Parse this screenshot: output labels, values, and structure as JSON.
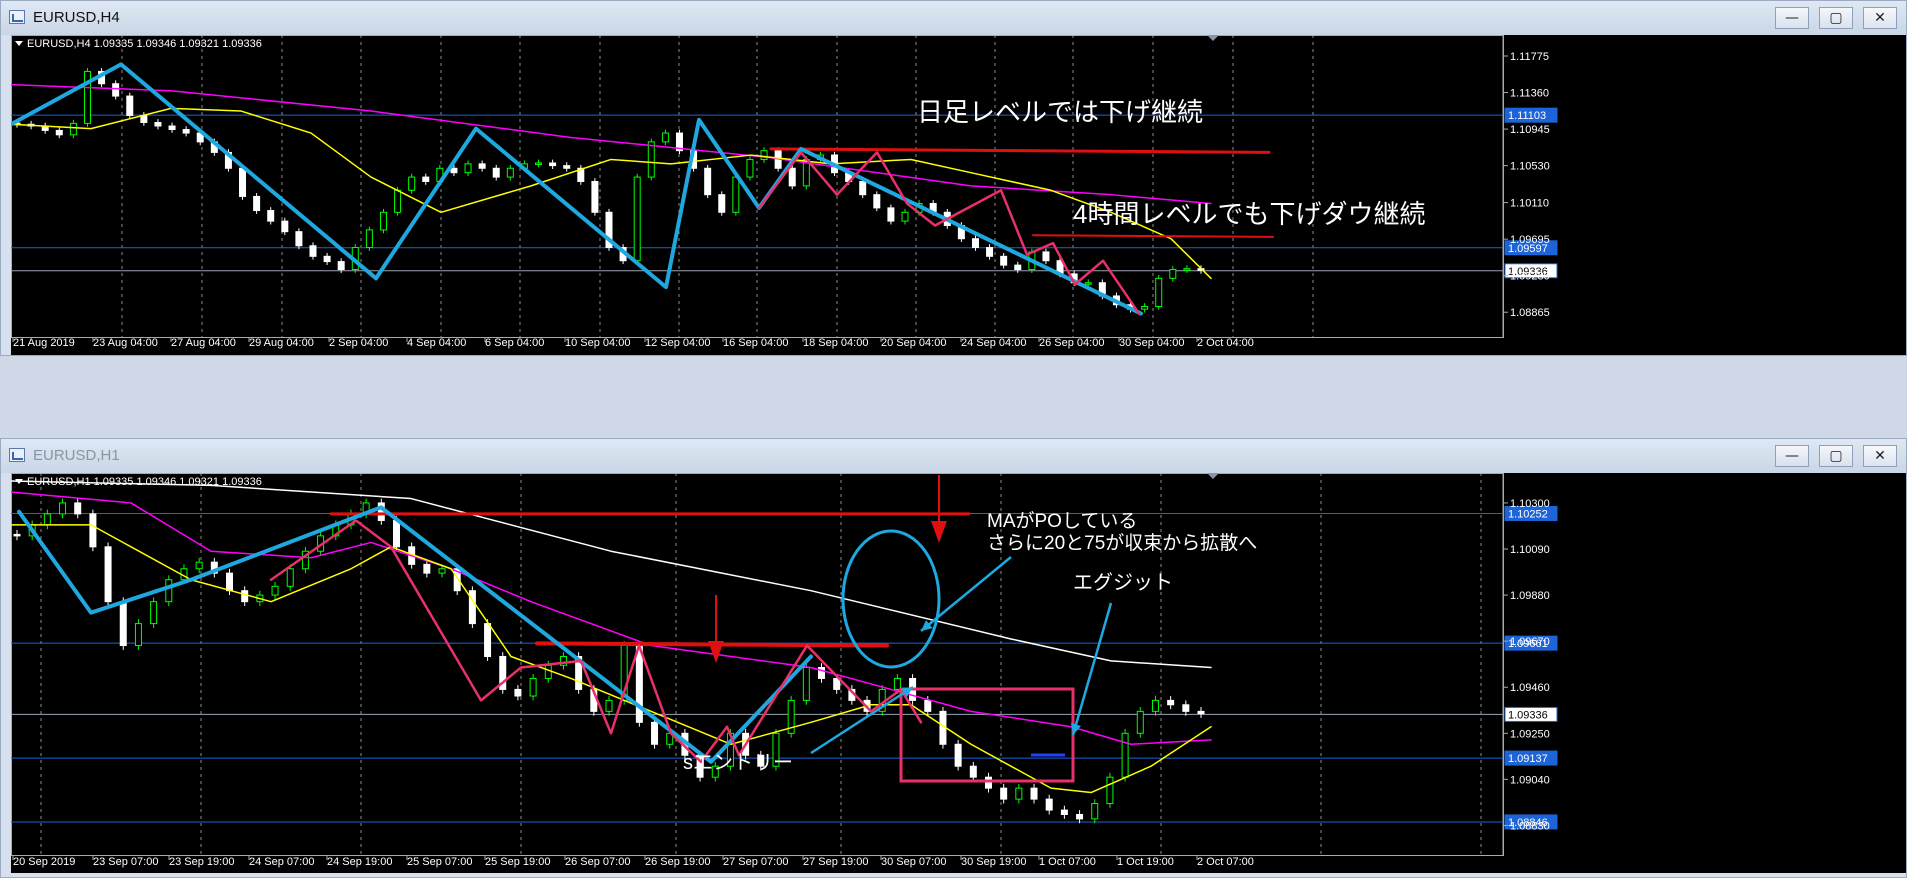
{
  "windows": [
    {
      "title": "EURUSD,H4",
      "active": true,
      "buttons": {
        "minimize": "—",
        "maximize": "▢",
        "close": "✕"
      },
      "info": "EURUSD,H4  1.09335 1.09346 1.09321 1.09336",
      "price_ticks": [
        "1.11775",
        "1.11360",
        "1.10945",
        "1.10530",
        "1.10110",
        "1.09695",
        "1.09280",
        "1.08865"
      ],
      "price_levels": [
        {
          "value": "1.11103",
          "style": "blue"
        },
        {
          "value": "1.09597",
          "style": "blue"
        },
        {
          "value": "1.09336",
          "style": "white"
        }
      ],
      "time_ticks": [
        "21 Aug 2019",
        "23 Aug 04:00",
        "27 Aug 04:00",
        "29 Aug 04:00",
        "2 Sep 04:00",
        "4 Sep 04:00",
        "6 Sep 04:00",
        "10 Sep 04:00",
        "12 Sep 04:00",
        "16 Sep 04:00",
        "18 Sep 04:00",
        "20 Sep 04:00",
        "24 Sep 04:00",
        "26 Sep 04:00",
        "30 Sep 04:00",
        "2 Oct 04:00"
      ],
      "annotations": [
        "日足レベルでは下げ継続",
        "4時間レベルでも下げダウ継続"
      ]
    },
    {
      "title": "EURUSD,H1",
      "active": false,
      "buttons": {
        "minimize": "—",
        "maximize": "▢",
        "close": "✕"
      },
      "info": "EURUSD,H1  1.09335 1.09346 1.09321 1.09336",
      "price_ticks": [
        "1.10300",
        "1.10090",
        "1.09880",
        "1.09670",
        "1.09460",
        "1.09250",
        "1.09040",
        "1.08830"
      ],
      "price_levels": [
        {
          "value": "1.10252",
          "style": "blue"
        },
        {
          "value": "1.09661",
          "style": "blue"
        },
        {
          "value": "1.09336",
          "style": "white"
        },
        {
          "value": "1.09137",
          "style": "blue"
        },
        {
          "value": "1.08846",
          "style": "blue"
        }
      ],
      "time_ticks": [
        "20 Sep 2019",
        "23 Sep 07:00",
        "23 Sep 19:00",
        "24 Sep 07:00",
        "24 Sep 19:00",
        "25 Sep 07:00",
        "25 Sep 19:00",
        "26 Sep 07:00",
        "26 Sep 19:00",
        "27 Sep 07:00",
        "27 Sep 19:00",
        "30 Sep 07:00",
        "30 Sep 19:00",
        "1 Oct 07:00",
        "1 Oct 19:00",
        "2 Oct 07:00"
      ],
      "annotations": [
        "MAがPOしている",
        "さらに20と75が収束から拡散へ",
        "エグジット",
        "sエントリー"
      ]
    }
  ],
  "colors": {
    "chart_bg": "#000000",
    "bull_candle": "#00ff00",
    "bear_candle": "#ffffff",
    "ma_fast": "#ffff00",
    "ma_slow": "#ff00ff",
    "ma_long": "#ffffff",
    "trend_line": "#1fa8e0",
    "zigzag": "#e8306a",
    "resistance": "#e01010",
    "level_line": "#1c64d8",
    "grid": "#c8c8c8"
  },
  "chart_data": [
    {
      "type": "candlestick",
      "symbol": "EURUSD",
      "timeframe": "H4",
      "title": "EURUSD,H4",
      "last_bar": {
        "open": 1.09335,
        "high": 1.09346,
        "low": 1.09321,
        "close": 1.09336
      },
      "ylim": [
        1.0872,
        1.119
      ],
      "y_ticks": [
        1.11775,
        1.1136,
        1.10945,
        1.1053,
        1.1011,
        1.09695,
        1.0928,
        1.08865
      ],
      "x_ticks": [
        "21 Aug 2019",
        "23 Aug 04:00",
        "27 Aug 04:00",
        "29 Aug 04:00",
        "2 Sep 04:00",
        "4 Sep 04:00",
        "6 Sep 04:00",
        "10 Sep 04:00",
        "12 Sep 04:00",
        "16 Sep 04:00",
        "18 Sep 04:00",
        "20 Sep 04:00",
        "24 Sep 04:00",
        "26 Sep 04:00",
        "30 Sep 04:00",
        "2 Oct 04:00"
      ],
      "horizontal_levels": [
        1.11103,
        1.09597,
        1.09336
      ],
      "close_path": [
        1.11,
        1.1098,
        1.1093,
        1.1088,
        1.1101,
        1.116,
        1.1146,
        1.1132,
        1.111,
        1.1102,
        1.1098,
        1.1094,
        1.109,
        1.108,
        1.1068,
        1.105,
        1.1018,
        1.1002,
        1.099,
        1.0978,
        1.0962,
        1.095,
        1.0944,
        1.0935,
        1.096,
        1.098,
        1.1,
        1.1025,
        1.104,
        1.1035,
        1.105,
        1.1045,
        1.1055,
        1.105,
        1.104,
        1.105,
        1.1055,
        1.1056,
        1.1053,
        1.105,
        1.1035,
        1.1,
        1.096,
        1.0945,
        1.104,
        1.108,
        1.109,
        1.107,
        1.105,
        1.102,
        1.1,
        1.104,
        1.106,
        1.107,
        1.105,
        1.103,
        1.106,
        1.1065,
        1.1045,
        1.1035,
        1.102,
        1.1005,
        1.099,
        1.1,
        1.101,
        1.1,
        1.0985,
        1.097,
        1.096,
        1.095,
        1.094,
        1.0935,
        1.0955,
        1.0945,
        1.093,
        1.092,
        1.092,
        1.0905,
        1.0895,
        1.089,
        1.0893,
        1.0925,
        1.0935,
        1.0936,
        1.0934
      ],
      "ma_fast_path": [
        [
          0,
          1.11
        ],
        [
          80,
          1.1095
        ],
        [
          160,
          1.1118
        ],
        [
          230,
          1.1115
        ],
        [
          300,
          1.109
        ],
        [
          360,
          1.104
        ],
        [
          430,
          1.1
        ],
        [
          520,
          1.103
        ],
        [
          600,
          1.106
        ],
        [
          660,
          1.1055
        ],
        [
          740,
          1.1065
        ],
        [
          820,
          1.1055
        ],
        [
          900,
          1.106
        ],
        [
          960,
          1.1045
        ],
        [
          1040,
          1.1025
        ],
        [
          1100,
          1.1
        ],
        [
          1160,
          1.097
        ],
        [
          1200,
          1.0925
        ]
      ],
      "ma_slow_path": [
        [
          0,
          1.1145
        ],
        [
          160,
          1.1138
        ],
        [
          360,
          1.1115
        ],
        [
          560,
          1.1085
        ],
        [
          760,
          1.1062
        ],
        [
          960,
          1.103
        ],
        [
          1100,
          1.102
        ],
        [
          1200,
          1.101
        ]
      ],
      "trend_path": [
        [
          0,
          1.11
        ],
        [
          110,
          1.1168
        ],
        [
          365,
          1.0925
        ],
        [
          465,
          1.1095
        ],
        [
          655,
          1.0915
        ],
        [
          688,
          1.1105
        ],
        [
          748,
          1.1005
        ],
        [
          790,
          1.1072
        ],
        [
          1130,
          1.0885
        ]
      ],
      "zigzag_path": [
        [
          748,
          1.1005
        ],
        [
          790,
          1.1068
        ],
        [
          826,
          1.102
        ],
        [
          866,
          1.1068
        ],
        [
          896,
          1.101
        ],
        [
          924,
          1.0985
        ],
        [
          990,
          1.1025
        ],
        [
          1016,
          1.0952
        ],
        [
          1042,
          1.0965
        ],
        [
          1064,
          1.0918
        ],
        [
          1092,
          1.0945
        ],
        [
          1128,
          1.0885
        ]
      ],
      "resistance_path": [
        [
          760,
          1.1072
        ],
        [
          1258,
          1.1068
        ]
      ],
      "resistance2_path": [
        [
          1022,
          1.0974
        ],
        [
          1262,
          1.0972
        ]
      ]
    },
    {
      "type": "candlestick",
      "symbol": "EURUSD",
      "timeframe": "H1",
      "title": "EURUSD,H1",
      "last_bar": {
        "open": 1.09335,
        "high": 1.09346,
        "low": 1.09321,
        "close": 1.09336
      },
      "ylim": [
        1.0875,
        1.104
      ],
      "y_ticks": [
        1.103,
        1.1009,
        1.0988,
        1.0967,
        1.0946,
        1.0925,
        1.0904,
        1.0883
      ],
      "x_ticks": [
        "20 Sep 2019",
        "23 Sep 07:00",
        "23 Sep 19:00",
        "24 Sep 07:00",
        "24 Sep 19:00",
        "25 Sep 07:00",
        "25 Sep 19:00",
        "26 Sep 07:00",
        "26 Sep 19:00",
        "27 Sep 07:00",
        "27 Sep 19:00",
        "30 Sep 07:00",
        "30 Sep 19:00",
        "1 Oct 07:00",
        "1 Oct 19:00",
        "2 Oct 07:00"
      ],
      "horizontal_levels": [
        1.10252,
        1.09661,
        1.09336,
        1.09137,
        1.08846
      ],
      "close_path": [
        1.1015,
        1.102,
        1.1025,
        1.103,
        1.1025,
        1.101,
        1.0985,
        1.0965,
        1.0975,
        1.0985,
        1.0995,
        1.1,
        1.1003,
        1.0998,
        1.099,
        1.0985,
        1.0988,
        1.0992,
        1.1,
        1.1008,
        1.1015,
        1.102,
        1.1025,
        1.103,
        1.1022,
        1.101,
        1.1002,
        1.0998,
        1.1,
        1.099,
        1.0975,
        1.096,
        1.0945,
        1.0942,
        1.095,
        1.0956,
        1.096,
        1.0945,
        1.0935,
        1.094,
        1.0965,
        1.093,
        1.092,
        1.0925,
        1.0915,
        1.0905,
        1.091,
        1.0925,
        1.0915,
        1.091,
        1.0925,
        1.094,
        1.0955,
        1.095,
        1.0945,
        1.094,
        1.0935,
        1.0945,
        1.095,
        1.094,
        1.0935,
        1.092,
        1.091,
        1.0905,
        1.09,
        1.0895,
        1.09,
        1.0895,
        1.089,
        1.0888,
        1.0886,
        1.0893,
        1.0905,
        1.0925,
        1.0935,
        1.094,
        1.0938,
        1.0935,
        1.0934
      ],
      "ma_fast_path": [
        [
          0,
          1.102
        ],
        [
          80,
          1.102
        ],
        [
          180,
          1.0995
        ],
        [
          260,
          1.0985
        ],
        [
          340,
          1.1
        ],
        [
          380,
          1.101
        ],
        [
          440,
          1.1
        ],
        [
          500,
          1.096
        ],
        [
          560,
          1.095
        ],
        [
          640,
          1.0935
        ],
        [
          720,
          1.092
        ],
        [
          800,
          1.093
        ],
        [
          860,
          1.0938
        ],
        [
          900,
          1.0938
        ],
        [
          960,
          1.092
        ],
        [
          1040,
          1.09
        ],
        [
          1080,
          1.0898
        ],
        [
          1140,
          1.091
        ],
        [
          1200,
          1.0928
        ]
      ],
      "ma_slow_path": [
        [
          0,
          1.1035
        ],
        [
          120,
          1.103
        ],
        [
          200,
          1.1008
        ],
        [
          300,
          1.1005
        ],
        [
          360,
          1.1012
        ],
        [
          440,
          1.1
        ],
        [
          520,
          1.0985
        ],
        [
          640,
          1.0965
        ],
        [
          800,
          1.0955
        ],
        [
          880,
          1.0945
        ],
        [
          960,
          1.0935
        ],
        [
          1060,
          1.0928
        ],
        [
          1120,
          1.092
        ],
        [
          1200,
          1.0922
        ]
      ],
      "ma_long_path": [
        [
          0,
          1.104
        ],
        [
          200,
          1.1038
        ],
        [
          400,
          1.1032
        ],
        [
          600,
          1.1008
        ],
        [
          800,
          1.099
        ],
        [
          1000,
          1.0968
        ],
        [
          1100,
          1.0958
        ],
        [
          1200,
          1.0955
        ]
      ],
      "trend_path": [
        [
          8,
          1.1026
        ],
        [
          80,
          1.098
        ],
        [
          180,
          1.0995
        ],
        [
          370,
          1.1028
        ],
        [
          700,
          1.0912
        ],
        [
          800,
          1.096
        ]
      ],
      "zigzag_path": [
        [
          260,
          1.0995
        ],
        [
          345,
          1.1022
        ],
        [
          380,
          1.101
        ],
        [
          470,
          1.094
        ],
        [
          510,
          1.0955
        ],
        [
          570,
          1.0958
        ],
        [
          600,
          1.0925
        ],
        [
          628,
          1.0965
        ],
        [
          660,
          1.0925
        ],
        [
          690,
          1.0912
        ],
        [
          716,
          1.0928
        ],
        [
          728,
          1.0915
        ],
        [
          796,
          1.0965
        ],
        [
          860,
          1.0935
        ],
        [
          890,
          1.0945
        ],
        [
          910,
          1.093
        ]
      ],
      "resistance_path": [
        [
          320,
          1.1025
        ],
        [
          958,
          1.1025
        ]
      ],
      "resistance2_path": [
        [
          526,
          1.0966
        ],
        [
          876,
          1.0965
        ]
      ]
    }
  ]
}
